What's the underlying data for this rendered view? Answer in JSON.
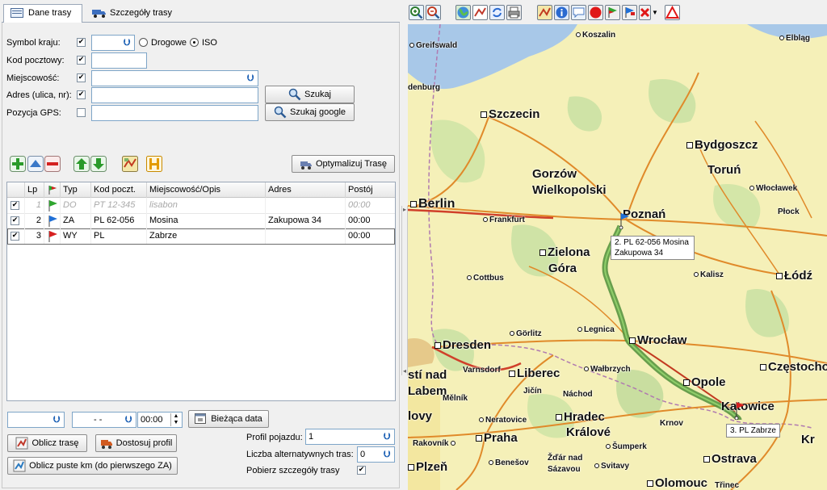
{
  "tabs": {
    "route_data": "Dane trasy",
    "route_details": "Szczegóły trasy"
  },
  "form": {
    "country_label": "Symbol kraju:",
    "road_option": "Drogowe",
    "iso_option": "ISO",
    "postal_label": "Kod pocztowy:",
    "city_label": "Miejscowość:",
    "address_label": "Adres (ulica, nr):",
    "gps_label": "Pozycja GPS:",
    "search_button": "Szukaj",
    "search_google_button": "Szukaj google"
  },
  "toolbar_left": {
    "optimize_button": "Optymalizuj Trasę"
  },
  "grid": {
    "columns": [
      "Lp",
      "",
      "Typ",
      "Kod poczt.",
      "Miejscowość/Opis",
      "Adres",
      "Postój"
    ],
    "rows": [
      {
        "checked": true,
        "lp": "1",
        "flag_color": "#2fa52f",
        "type": "DO",
        "postal": "PT 12-345",
        "city": "lisabon",
        "address": "",
        "stop": "00:00"
      },
      {
        "checked": true,
        "lp": "2",
        "flag_color": "#1f6fd6",
        "type": "ZA",
        "postal": "PL 62-056",
        "city": "Mosina",
        "address": "Zakupowa 34",
        "stop": "00:00"
      },
      {
        "checked": true,
        "lp": "3",
        "flag_color": "#d62020",
        "type": "WY",
        "postal": "PL",
        "city": "Zabrze",
        "address": "",
        "stop": "00:00"
      }
    ]
  },
  "bottom": {
    "date_value": "- -",
    "time_value": "00:00",
    "current_date_button": "Bieżąca data",
    "calc_route_button": "Oblicz trasę",
    "adjust_profile_button": "Dostosuj profil",
    "calc_empty_km_button": "Oblicz puste km (do pierwszego ZA)",
    "vehicle_profile_label": "Profil pojazdu:",
    "vehicle_profile_value": "1",
    "alt_routes_label": "Liczba alternatywnych tras:",
    "alt_routes_value": "0",
    "fetch_details_label": "Pobierz szczegóły trasy"
  },
  "map": {
    "cities": {
      "koszalin": "Koszalin",
      "elblag": "Elbląg",
      "greifswald": "Greifswald",
      "denburg": "denburg",
      "szczecin": "Szczecin",
      "bydgoszcz": "Bydgoszcz",
      "torun": "Toruń",
      "gorzow1": "Gorzów",
      "gorzow2": "Wielkopolski",
      "wloclawek": "Włocławek",
      "plock": "Płock",
      "berlin": "Berlin",
      "frankfurt": "Frankfurt",
      "poznan": "Poznań",
      "zielona1": "Zielona",
      "zielona2": "Góra",
      "kalisz": "Kalisz",
      "lodz": "Łódź",
      "cottbus": "Cottbus",
      "gorlitz": "Görlitz",
      "legnica": "Legnica",
      "wroclaw": "Wrocław",
      "dresden": "Dresden",
      "varnsdorf": "Varnsdorf",
      "liberec": "Liberec",
      "walbrzych": "Wałbrzych",
      "opole": "Opole",
      "czestochowa": "Częstochow",
      "usti1": "stí nad",
      "usti2": "Labem",
      "melnik": "Mělník",
      "jicin": "Jičín",
      "nachod": "Náchod",
      "katowice": "Katowice",
      "lovy": "lovy",
      "neratovice": "Neratovice",
      "hradec1": "Hradec",
      "hradec2": "Králové",
      "krnov": "Krnov",
      "rakovnik": "Rakovník",
      "praha": "Praha",
      "sumperk": "Šumperk",
      "kr": "Kr",
      "ostrava": "Ostrava",
      "plzen": "Plzeň",
      "benesov": "Benešov",
      "zdar1": "Žďár nad",
      "zdar2": "Sázavou",
      "svitavy": "Svitavy",
      "olomouc": "Olomouc",
      "trinec": "Třinec"
    },
    "tooltip_point2_line1": "2. PL 62-056 Mosina",
    "tooltip_point2_line2": "Zakupowa 34",
    "tooltip_point3": "3. PL  Zabrze"
  }
}
